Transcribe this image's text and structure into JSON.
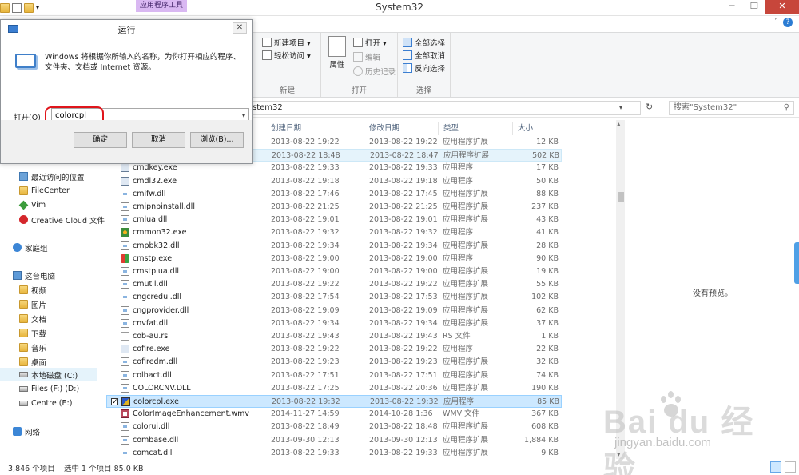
{
  "window": {
    "title": "System32",
    "context_tab": "应用程序工具",
    "help": "?",
    "minimize": "─",
    "maximize": "❐",
    "close": "✕"
  },
  "ribbon": {
    "new_group": {
      "new_item": "新建项目 ▾",
      "easy_access": "轻松访问 ▾",
      "name": "新建"
    },
    "open_group": {
      "properties": "属性",
      "open": "打开 ▾",
      "edit": "编辑",
      "history": "历史记录",
      "name": "打开"
    },
    "select_group": {
      "select_all": "全部选择",
      "select_none": "全部取消",
      "invert": "反向选择",
      "name": "选择"
    }
  },
  "address": {
    "path_tail": "stem32",
    "search_placeholder": "搜索\"System32\""
  },
  "nav": {
    "recent": "最近访问的位置",
    "filecenter": "FileCenter",
    "vim": "Vim",
    "creative_cloud": "Creative Cloud 文件",
    "homegroup": "家庭组",
    "this_pc": "这台电脑",
    "videos": "视频",
    "pictures": "图片",
    "documents": "文档",
    "downloads": "下载",
    "music": "音乐",
    "desktop": "桌面",
    "local_disk": "本地磁盘 (C:)",
    "files_d": "Files (F:) (D:)",
    "centre_e": "Centre (E:)",
    "network": "网络"
  },
  "columns": {
    "created": "创建日期",
    "modified": "修改日期",
    "type": "类型",
    "size": "大小"
  },
  "files": [
    {
      "name": "",
      "created": "2013-08-22 19:22",
      "modified": "2013-08-22 19:22",
      "type": "应用程序扩展",
      "size": "12 KB",
      "icon": "dll"
    },
    {
      "name": "",
      "created": "2013-08-22 18:48",
      "modified": "2013-08-22 18:47",
      "type": "应用程序扩展",
      "size": "502 KB",
      "icon": "dll"
    },
    {
      "name": "cmdkey.exe",
      "created": "2013-08-22 19:33",
      "modified": "2013-08-22 19:33",
      "type": "应用程序",
      "size": "17 KB",
      "icon": "exe"
    },
    {
      "name": "cmdl32.exe",
      "created": "2013-08-22 19:18",
      "modified": "2013-08-22 19:18",
      "type": "应用程序",
      "size": "50 KB",
      "icon": "exe"
    },
    {
      "name": "cmifw.dll",
      "created": "2013-08-22 17:46",
      "modified": "2013-08-22 17:45",
      "type": "应用程序扩展",
      "size": "88 KB",
      "icon": "dll"
    },
    {
      "name": "cmipnpinstall.dll",
      "created": "2013-08-22 21:25",
      "modified": "2013-08-22 21:25",
      "type": "应用程序扩展",
      "size": "237 KB",
      "icon": "dll"
    },
    {
      "name": "cmlua.dll",
      "created": "2013-08-22 19:01",
      "modified": "2013-08-22 19:01",
      "type": "应用程序扩展",
      "size": "43 KB",
      "icon": "dll"
    },
    {
      "name": "cmmon32.exe",
      "created": "2013-08-22 19:32",
      "modified": "2013-08-22 19:32",
      "type": "应用程序",
      "size": "41 KB",
      "icon": "exe3"
    },
    {
      "name": "cmpbk32.dll",
      "created": "2013-08-22 19:34",
      "modified": "2013-08-22 19:34",
      "type": "应用程序扩展",
      "size": "28 KB",
      "icon": "dll"
    },
    {
      "name": "cmstp.exe",
      "created": "2013-08-22 19:00",
      "modified": "2013-08-22 19:00",
      "type": "应用程序",
      "size": "90 KB",
      "icon": "exe2"
    },
    {
      "name": "cmstplua.dll",
      "created": "2013-08-22 19:00",
      "modified": "2013-08-22 19:00",
      "type": "应用程序扩展",
      "size": "19 KB",
      "icon": "dll"
    },
    {
      "name": "cmutil.dll",
      "created": "2013-08-22 19:22",
      "modified": "2013-08-22 19:22",
      "type": "应用程序扩展",
      "size": "55 KB",
      "icon": "dll"
    },
    {
      "name": "cngcredui.dll",
      "created": "2013-08-22 17:54",
      "modified": "2013-08-22 17:53",
      "type": "应用程序扩展",
      "size": "102 KB",
      "icon": "dll"
    },
    {
      "name": "cngprovider.dll",
      "created": "2013-08-22 19:09",
      "modified": "2013-08-22 19:09",
      "type": "应用程序扩展",
      "size": "62 KB",
      "icon": "dll"
    },
    {
      "name": "cnvfat.dll",
      "created": "2013-08-22 19:34",
      "modified": "2013-08-22 19:34",
      "type": "应用程序扩展",
      "size": "37 KB",
      "icon": "dll"
    },
    {
      "name": "cob-au.rs",
      "created": "2013-08-22 19:43",
      "modified": "2013-08-22 19:43",
      "type": "RS 文件",
      "size": "1 KB",
      "icon": "rs"
    },
    {
      "name": "cofire.exe",
      "created": "2013-08-22 19:22",
      "modified": "2013-08-22 19:22",
      "type": "应用程序",
      "size": "22 KB",
      "icon": "exe"
    },
    {
      "name": "cofiredm.dll",
      "created": "2013-08-22 19:23",
      "modified": "2013-08-22 19:23",
      "type": "应用程序扩展",
      "size": "32 KB",
      "icon": "dll"
    },
    {
      "name": "colbact.dll",
      "created": "2013-08-22 17:51",
      "modified": "2013-08-22 17:51",
      "type": "应用程序扩展",
      "size": "74 KB",
      "icon": "dll"
    },
    {
      "name": "COLORCNV.DLL",
      "created": "2013-08-22 17:25",
      "modified": "2013-08-22 20:36",
      "type": "应用程序扩展",
      "size": "190 KB",
      "icon": "dll"
    },
    {
      "name": "colorcpl.exe",
      "created": "2013-08-22 19:32",
      "modified": "2013-08-22 19:32",
      "type": "应用程序",
      "size": "85 KB",
      "icon": "color"
    },
    {
      "name": "ColorImageEnhancement.wmv",
      "created": "2014-11-27 14:59",
      "modified": "2014-10-28 1:36",
      "type": "WMV 文件",
      "size": "367 KB",
      "icon": "wmv"
    },
    {
      "name": "colorui.dll",
      "created": "2013-08-22 18:49",
      "modified": "2013-08-22 18:48",
      "type": "应用程序扩展",
      "size": "608 KB",
      "icon": "dll"
    },
    {
      "name": "combase.dll",
      "created": "2013-09-30 12:13",
      "modified": "2013-09-30 12:13",
      "type": "应用程序扩展",
      "size": "1,884 KB",
      "icon": "dll"
    },
    {
      "name": "comcat.dll",
      "created": "2013-08-22 19:33",
      "modified": "2013-08-22 19:33",
      "type": "应用程序扩展",
      "size": "9 KB",
      "icon": "dll"
    }
  ],
  "preview": {
    "message": "没有预览。"
  },
  "status": {
    "count": "3,846 个项目",
    "selection": "选中 1 个项目  85.0 KB"
  },
  "watermark": {
    "brand": "Bai du 经验",
    "url": "jingyan.baidu.com"
  },
  "run_dialog": {
    "title": "运行",
    "close": "✕",
    "description": "Windows 将根据你所输入的名称，为你打开相应的程序、文件夹、文档或 Internet 资源。",
    "open_label": "打开(O):",
    "input_value": "colorcpl",
    "ok": "确定",
    "cancel": "取消",
    "browse": "浏览(B)..."
  }
}
